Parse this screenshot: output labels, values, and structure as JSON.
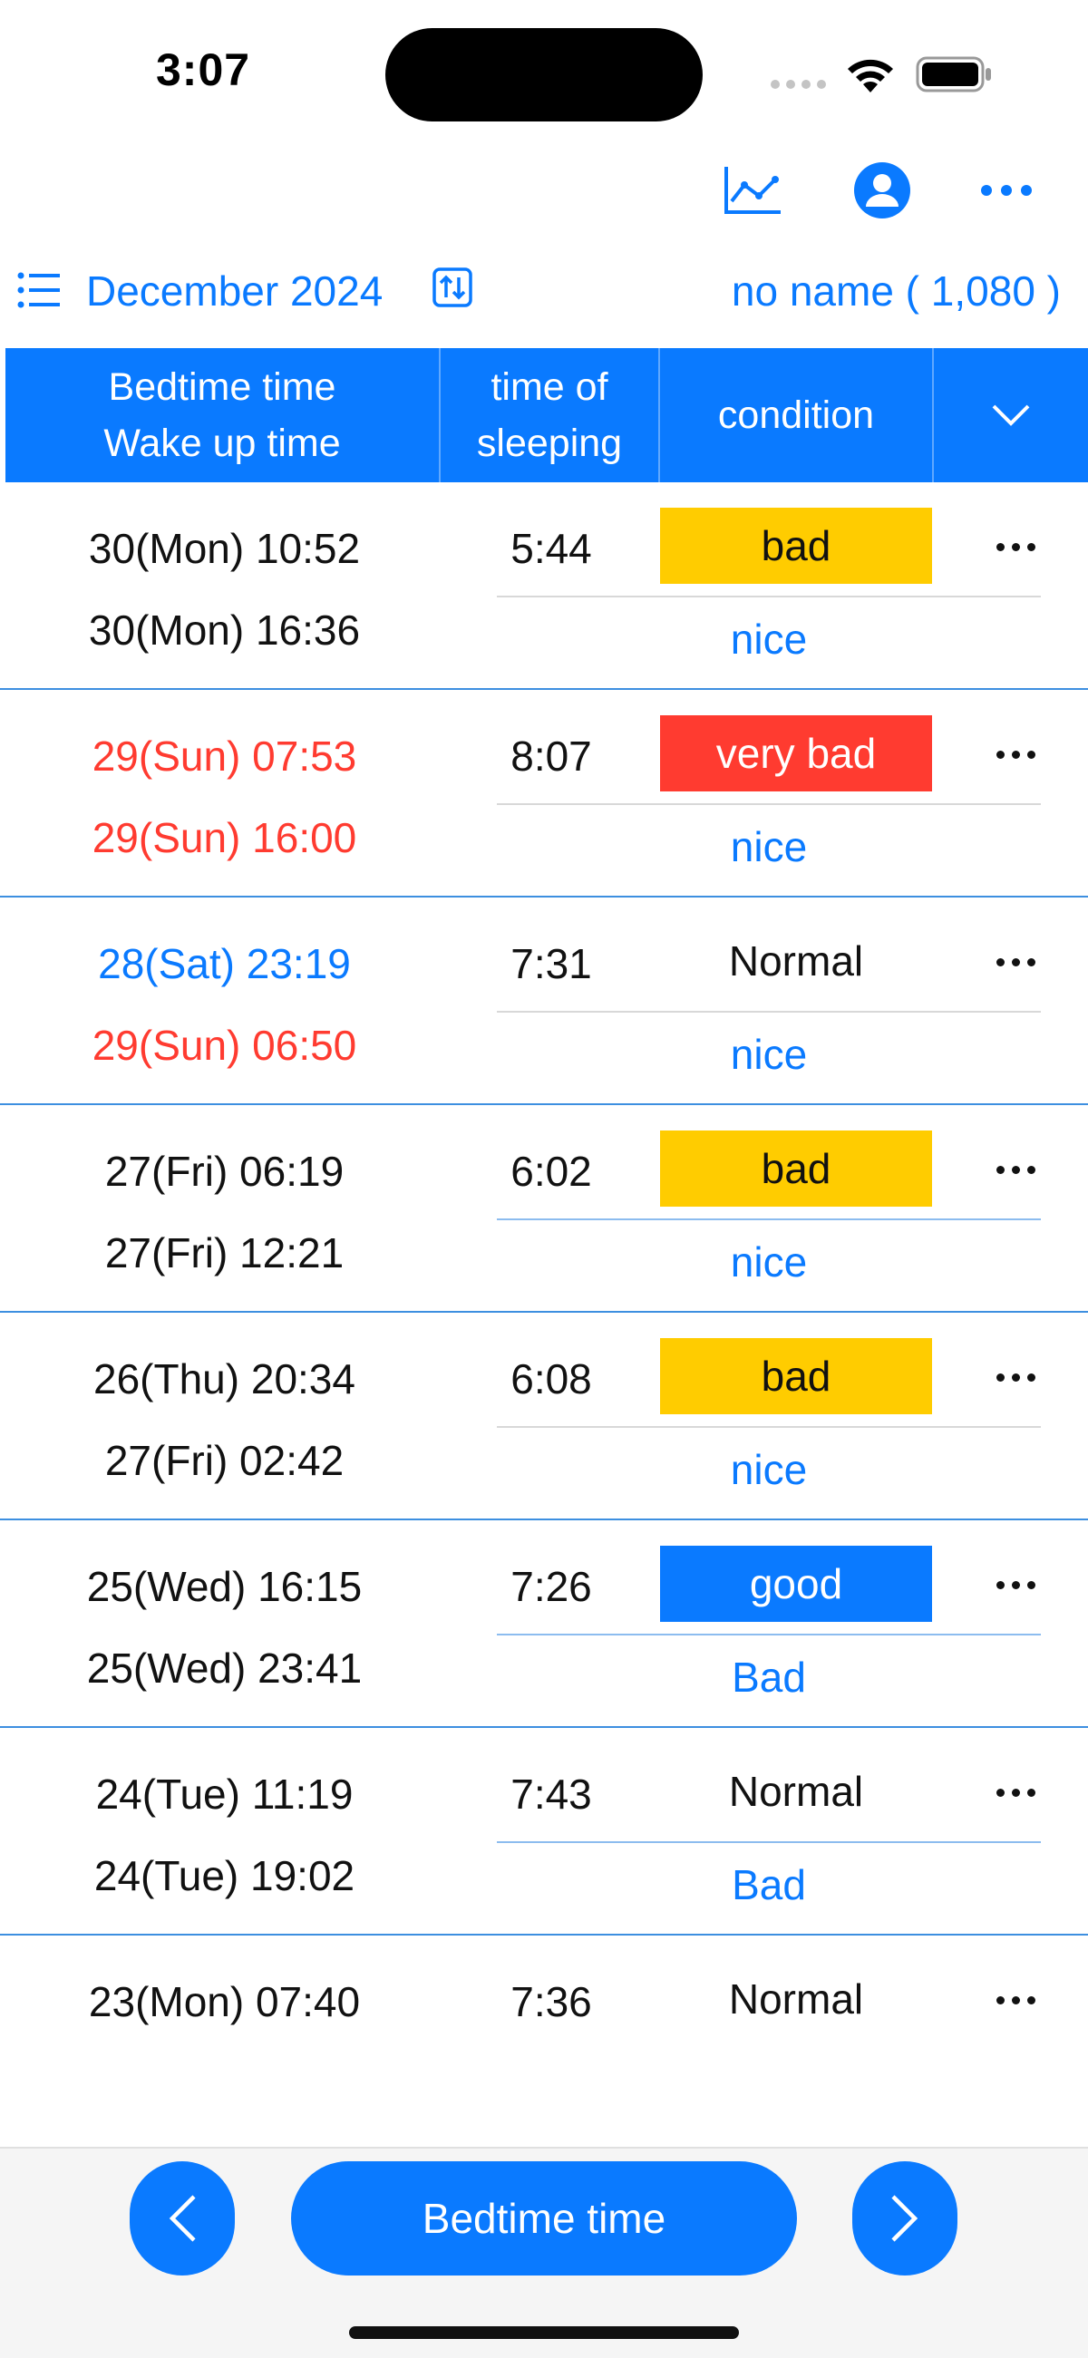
{
  "status_bar": {
    "time": "3:07"
  },
  "toolbar": {
    "icons": [
      "chart-line-icon",
      "user-circle-icon",
      "more-horizontal-icon"
    ]
  },
  "month_row": {
    "month": "December 2024",
    "user": "no name  ( 1,080 )"
  },
  "table_header": {
    "col1_line1": "Bedtime time",
    "col1_line2": "Wake up time",
    "col2_line1": "time of",
    "col2_line2": "sleeping",
    "col3": "condition"
  },
  "rows": [
    {
      "bedtime": "30(Mon) 10:52",
      "wakeup": "30(Mon) 16:36",
      "bedtime_color": "black",
      "wakeup_color": "black",
      "duration": "5:44",
      "condition": "bad",
      "condition_style": "bad",
      "rating": "nice"
    },
    {
      "bedtime": "29(Sun) 07:53",
      "wakeup": "29(Sun) 16:00",
      "bedtime_color": "red",
      "wakeup_color": "red",
      "duration": "8:07",
      "condition": "very bad",
      "condition_style": "verybad",
      "rating": "nice"
    },
    {
      "bedtime": "28(Sat) 23:19",
      "wakeup": "29(Sun) 06:50",
      "bedtime_color": "blue",
      "wakeup_color": "red",
      "duration": "7:31",
      "condition": "Normal",
      "condition_style": "normal",
      "rating": "nice"
    },
    {
      "bedtime": "27(Fri) 06:19",
      "wakeup": "27(Fri) 12:21",
      "bedtime_color": "black",
      "wakeup_color": "black",
      "duration": "6:02",
      "condition": "bad",
      "condition_style": "bad",
      "rating": "nice"
    },
    {
      "bedtime": "26(Thu) 20:34",
      "wakeup": "27(Fri) 02:42",
      "bedtime_color": "black",
      "wakeup_color": "black",
      "duration": "6:08",
      "condition": "bad",
      "condition_style": "bad",
      "rating": "nice"
    },
    {
      "bedtime": "25(Wed) 16:15",
      "wakeup": "25(Wed) 23:41",
      "bedtime_color": "black",
      "wakeup_color": "black",
      "duration": "7:26",
      "condition": "good",
      "condition_style": "good",
      "rating": "Bad"
    },
    {
      "bedtime": "24(Tue) 11:19",
      "wakeup": "24(Tue) 19:02",
      "bedtime_color": "black",
      "wakeup_color": "black",
      "duration": "7:43",
      "condition": "Normal",
      "condition_style": "normal",
      "rating": "Bad"
    },
    {
      "bedtime": "23(Mon) 07:40",
      "wakeup": "",
      "bedtime_color": "black",
      "wakeup_color": "black",
      "duration": "7:36",
      "condition": "Normal",
      "condition_style": "normal",
      "rating": ""
    }
  ],
  "bottom_bar": {
    "mode_label": "Bedtime time"
  },
  "colors": {
    "accent": "#0a7aff",
    "bad": "#ffcc00",
    "very_bad": "#ff3b30",
    "good": "#0a7aff"
  }
}
